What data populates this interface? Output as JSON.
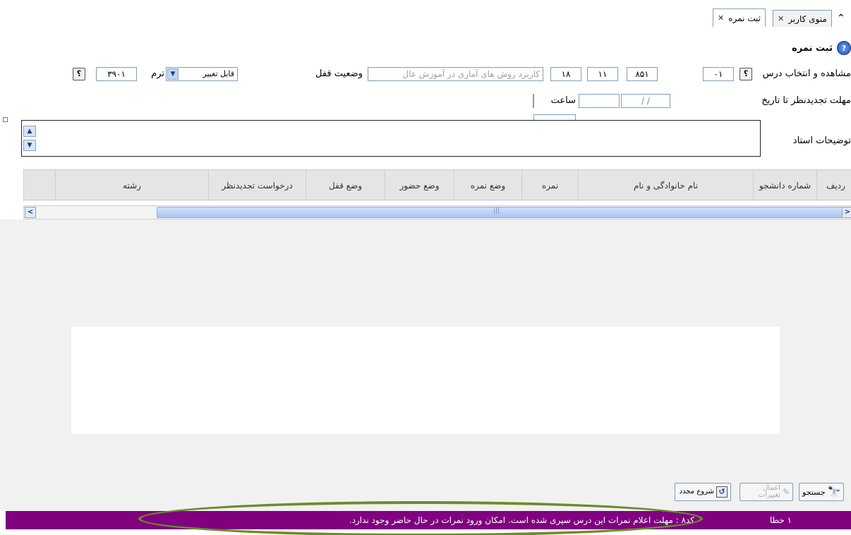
{
  "tabs": [
    {
      "label": "ثبت نمره",
      "active": true
    },
    {
      "label": "منوی کاربر",
      "active": false
    }
  ],
  "page_title": "ثبت نمره",
  "course_row": {
    "label": "مشاهده و انتخاب درس",
    "field1": "۰۱",
    "field2": "۸۵۱",
    "field3": "۱۱",
    "field4": "۱۸",
    "course_name": "کاربرد روش های آماری در آموزش عال",
    "lock_label": "وضعیت قفل",
    "lock_value": "قابل تغییر",
    "term_label": "ترم",
    "term_value": "۳۹۰۱",
    "help_glyph": "؟"
  },
  "deadline_row": {
    "label": "مهلت تجدیدنظر تا تاریخ",
    "date_placeholder": "/ /",
    "time_label": "ساعت"
  },
  "notes_label": "توضیحات استاد",
  "table_headers": [
    "ردیف",
    "شماره دانشجو",
    "نام خانوادگی و نام",
    "نمره",
    "وضع نمره",
    "وضع حضور",
    "وضع قفل",
    "درخواست تجدیدنظر",
    "رشته"
  ],
  "scroll_thumb_glyph": "|||",
  "toolbar": {
    "search": "جستجو",
    "apply": "اعمال تغییرات",
    "restart": "شروع مجدد"
  },
  "status": {
    "count": "۱ خطا",
    "message": "کد۸ : مهلت اعلام نمرات این درس سپری شده است. امکان ورود نمرات در حال حاضر وجود ندارد."
  },
  "colors": {
    "statusbar": "#80007f",
    "highlight_ellipse": "#6a8d2a"
  }
}
